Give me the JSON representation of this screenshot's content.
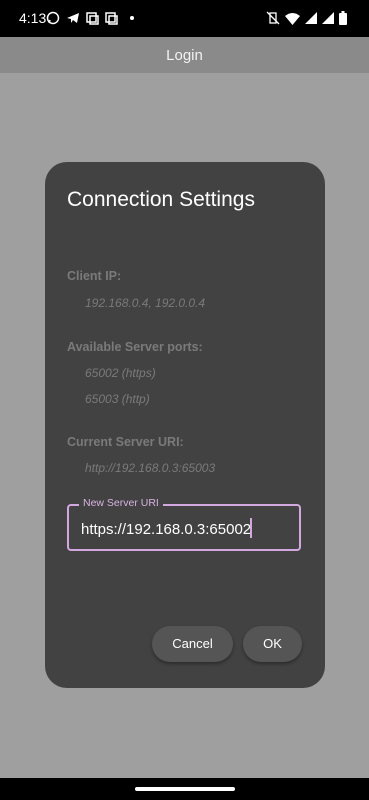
{
  "status_bar": {
    "time": "4:13",
    "icons_left": [
      "whatsapp-icon",
      "telegram-icon",
      "copy-icon",
      "copy-icon",
      "dot-icon"
    ],
    "icons_right": [
      "vibrate-off-icon",
      "wifi-icon",
      "signal-icon",
      "signal-icon",
      "battery-icon"
    ]
  },
  "app_bar": {
    "title": "Login"
  },
  "dialog": {
    "title": "Connection Settings",
    "client_ip": {
      "label": "Client IP:",
      "value": "192.168.0.4, 192.0.0.4"
    },
    "ports": {
      "label": "Available Server ports:",
      "values": [
        "65002 (https)",
        "65003 (http)"
      ]
    },
    "current_uri": {
      "label": "Current Server URI:",
      "value": "http://192.168.0.3:65003"
    },
    "new_uri": {
      "legend": "New Server URI",
      "value": "https://192.168.0.3:65002"
    },
    "buttons": {
      "cancel": "Cancel",
      "ok": "OK"
    }
  },
  "colors": {
    "dialog_bg": "#424242",
    "accent": "#d3a7df",
    "scrim": "#9f9f9f"
  }
}
